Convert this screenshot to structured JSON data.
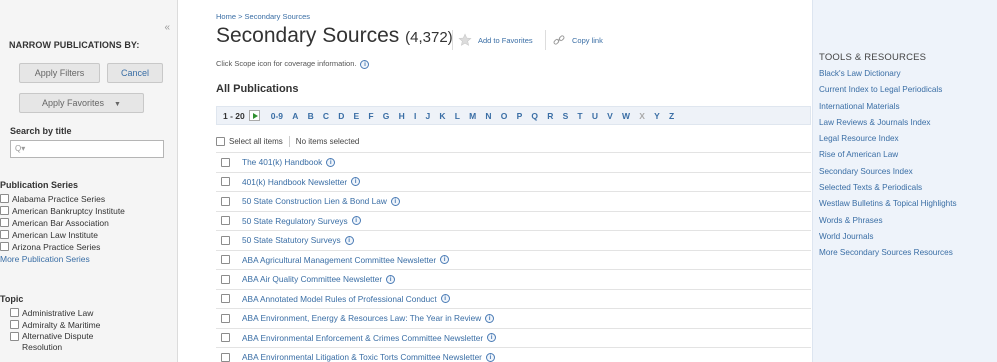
{
  "sidebar": {
    "collapse_glyph": "«",
    "narrow_title": "NARROW PUBLICATIONS BY:",
    "apply_filters_label": "Apply Filters",
    "cancel_label": "Cancel",
    "apply_favorites_label": "Apply Favorites",
    "search_label": "Search by title",
    "search_placeholder": "Q▾",
    "publication_series": {
      "title": "Publication Series",
      "items": [
        {
          "label": "Alabama Practice Series"
        },
        {
          "label": "American Bankruptcy Institute"
        },
        {
          "label": "American Bar Association"
        },
        {
          "label": "American Law Institute"
        },
        {
          "label": "Arizona Practice Series"
        }
      ],
      "more_label": "More Publication Series"
    },
    "topic": {
      "title": "Topic",
      "items": [
        {
          "label": "Administrative Law"
        },
        {
          "label": "Admiralty & Maritime"
        },
        {
          "label": "Alternative Dispute Resolution"
        }
      ]
    }
  },
  "main": {
    "breadcrumb": "Home > Secondary Sources",
    "title": "Secondary Sources",
    "count": "(4,372)",
    "add_favorites_label": "Add to Favorites",
    "copy_link_label": "Copy link",
    "scope_note": "Click Scope icon for coverage information.",
    "section_title": "All Publications",
    "range": "1 - 20",
    "letters": [
      {
        "label": "0-9",
        "enabled": true
      },
      {
        "label": "A",
        "enabled": true
      },
      {
        "label": "B",
        "enabled": true
      },
      {
        "label": "C",
        "enabled": true
      },
      {
        "label": "D",
        "enabled": true
      },
      {
        "label": "E",
        "enabled": true
      },
      {
        "label": "F",
        "enabled": true
      },
      {
        "label": "G",
        "enabled": true
      },
      {
        "label": "H",
        "enabled": true
      },
      {
        "label": "I",
        "enabled": true
      },
      {
        "label": "J",
        "enabled": true
      },
      {
        "label": "K",
        "enabled": true
      },
      {
        "label": "L",
        "enabled": true
      },
      {
        "label": "M",
        "enabled": true
      },
      {
        "label": "N",
        "enabled": true
      },
      {
        "label": "O",
        "enabled": true
      },
      {
        "label": "P",
        "enabled": true
      },
      {
        "label": "Q",
        "enabled": true
      },
      {
        "label": "R",
        "enabled": true
      },
      {
        "label": "S",
        "enabled": true
      },
      {
        "label": "T",
        "enabled": true
      },
      {
        "label": "U",
        "enabled": true
      },
      {
        "label": "V",
        "enabled": true
      },
      {
        "label": "W",
        "enabled": true
      },
      {
        "label": "X",
        "enabled": false
      },
      {
        "label": "Y",
        "enabled": true
      },
      {
        "label": "Z",
        "enabled": true
      }
    ],
    "select_all_label": "Select all items",
    "selection_status": "No items selected",
    "results": [
      {
        "title": "The 401(k) Handbook"
      },
      {
        "title": "401(k) Handbook Newsletter"
      },
      {
        "title": "50 State Construction Lien & Bond Law"
      },
      {
        "title": "50 State Regulatory Surveys"
      },
      {
        "title": "50 State Statutory Surveys"
      },
      {
        "title": "ABA Agricultural Management Committee Newsletter"
      },
      {
        "title": "ABA Air Quality Committee Newsletter"
      },
      {
        "title": "ABA Annotated Model Rules of Professional Conduct"
      },
      {
        "title": "ABA Environment, Energy & Resources Law: The Year in Review"
      },
      {
        "title": "ABA Environmental Enforcement & Crimes Committee Newsletter"
      },
      {
        "title": "ABA Environmental Litigation & Toxic Torts Committee Newsletter"
      }
    ]
  },
  "tools": {
    "title": "TOOLS & RESOURCES",
    "items": [
      {
        "label": "Black's Law Dictionary"
      },
      {
        "label": "Current Index to Legal Periodicals"
      },
      {
        "label": "International Materials"
      },
      {
        "label": "Law Reviews & Journals Index"
      },
      {
        "label": "Legal Resource Index"
      },
      {
        "label": "Rise of American Law"
      },
      {
        "label": "Secondary Sources Index"
      },
      {
        "label": "Selected Texts & Periodicals"
      },
      {
        "label": "Westlaw Bulletins & Topical Highlights"
      },
      {
        "label": "Words & Phrases"
      },
      {
        "label": "World Journals"
      },
      {
        "label": "More Secondary Sources Resources"
      }
    ]
  },
  "colors": {
    "link": "#3a6ea5",
    "sidebar_bg": "#f5f5f5",
    "tools_bg": "#eef3fa",
    "alpha_bar_bg": "#eef2f8",
    "next_arrow": "#2f8f2f"
  },
  "icons": {
    "collapse": "double-chevron-left-icon",
    "star": "star-icon",
    "copy": "link-icon",
    "info": "info-icon",
    "search": "search-icon",
    "next": "play-arrow-icon"
  }
}
